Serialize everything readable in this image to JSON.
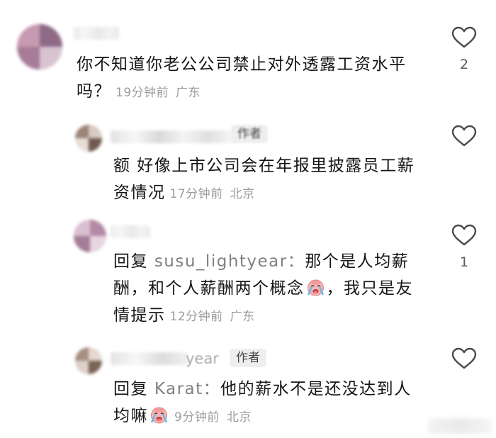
{
  "comments": [
    {
      "text": "你不知道你老公公司禁止对外透露工资水平吗？",
      "time": "19分钟前",
      "location": "广东",
      "likes": "2"
    },
    {
      "author_badge": "作者",
      "text": "额 好像上市公司会在年报里披露员工薪资情况",
      "time": "17分钟前",
      "location": "北京"
    },
    {
      "reply_prefix": "回复",
      "reply_target": "susu_lightyear：",
      "text_part1": "那个是人均薪酬，和个人薪酬两个概念",
      "text_part2": "，我只是友情提示",
      "emoji": "crying-face",
      "time": "12分钟前",
      "location": "广东",
      "likes": "1"
    },
    {
      "name_fragment": "year",
      "author_badge": "作者",
      "reply_prefix": "回复",
      "reply_target": "Karat：",
      "text_part1": "他的薪水不是还没达到人均嘛",
      "emoji": "crying-face",
      "time": "9分钟前",
      "location": "北京"
    }
  ],
  "icons": {
    "like": "heart-outline-icon",
    "emoji": "crying-face-emoji-icon"
  },
  "colors": {
    "text": "#161616",
    "meta": "#9c9c9c",
    "reply_target": "#808080",
    "badge_bg": "#eeeeee",
    "heart_stroke": "#4a4a4a",
    "emoji_face": "#f7b6b6",
    "emoji_tears": "#6ab8ea"
  }
}
